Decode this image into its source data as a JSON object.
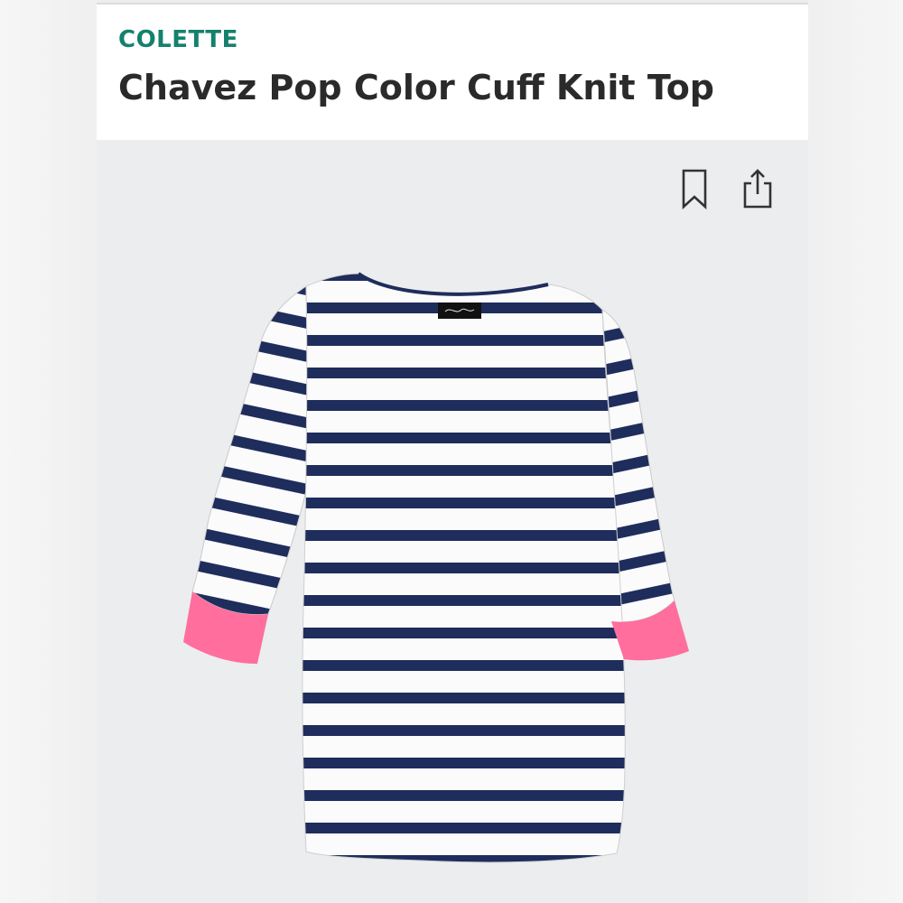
{
  "product": {
    "brand": "COLETTE",
    "title": "Chavez Pop Color Cuff Knit Top"
  },
  "actions": {
    "bookmark_icon": "bookmark-icon",
    "share_icon": "share-icon"
  },
  "colors": {
    "brand_text": "#14816e",
    "stripe_navy": "#1f2d5c",
    "body_white": "#fbfbfb",
    "cuff_pink": "#ff6e9c"
  }
}
